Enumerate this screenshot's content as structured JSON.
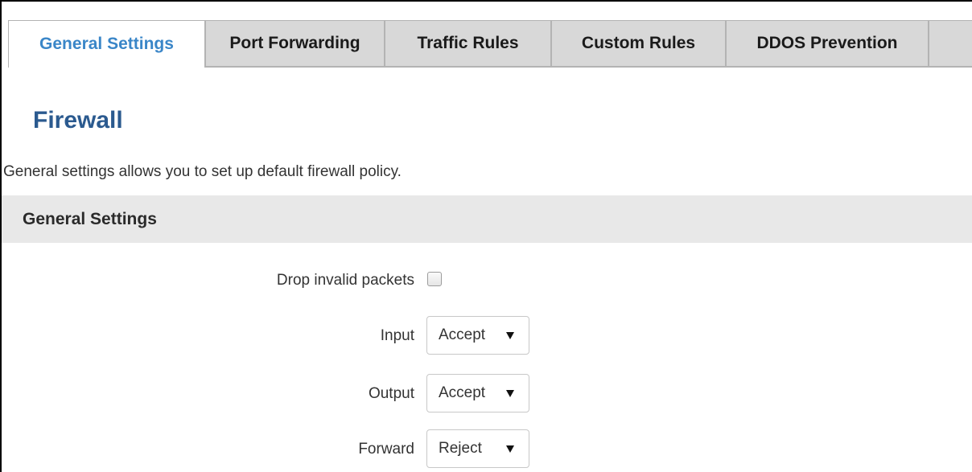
{
  "tabs": [
    {
      "label": "General Settings",
      "active": true
    },
    {
      "label": "Port Forwarding",
      "active": false
    },
    {
      "label": "Traffic Rules",
      "active": false
    },
    {
      "label": "Custom Rules",
      "active": false
    },
    {
      "label": "DDOS Prevention",
      "active": false
    }
  ],
  "page": {
    "title": "Firewall",
    "description": "General settings allows you to set up default firewall policy."
  },
  "section": {
    "title": "General Settings"
  },
  "settings": {
    "drop_invalid": {
      "label": "Drop invalid packets",
      "checked": false
    },
    "input": {
      "label": "Input",
      "value": "Accept"
    },
    "output": {
      "label": "Output",
      "value": "Accept"
    },
    "forward": {
      "label": "Forward",
      "value": "Reject"
    }
  },
  "colors": {
    "accent": "#3a86c8",
    "title": "#2b5a8f",
    "section_bg": "#e8e8e8",
    "tab_bg": "#d8d8d8"
  }
}
